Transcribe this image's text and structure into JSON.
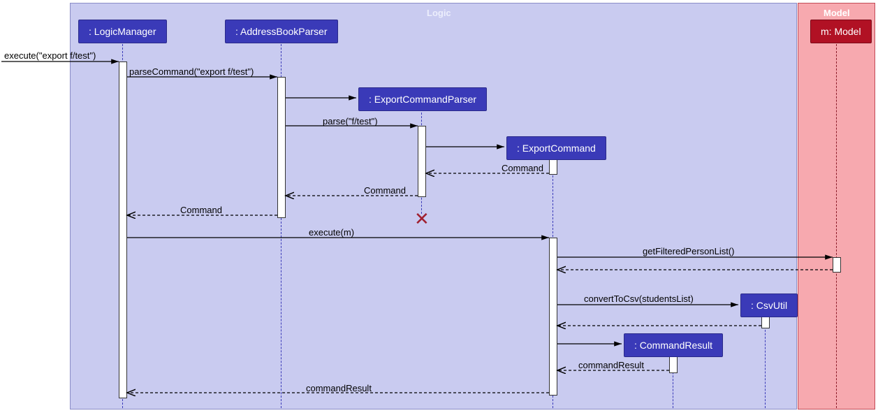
{
  "frames": {
    "logic": "Logic",
    "model": "Model"
  },
  "participants": {
    "logicManager": ": LogicManager",
    "addressBookParser": ": AddressBookParser",
    "exportCommandParser": ": ExportCommandParser",
    "exportCommand": ": ExportCommand",
    "csvUtil": ": CsvUtil",
    "commandResult": ": CommandResult",
    "model": "m: Model"
  },
  "messages": {
    "m1": "execute(\"export f/test\")",
    "m2": "parseCommand(\"export f/test\")",
    "m3": "parse(\"f/test\")",
    "r_command1": "Command",
    "r_command2": "Command",
    "r_command3": "Command",
    "m4": "execute(m)",
    "m5": "getFilteredPersonList()",
    "m6": "convertToCsv(studentsList)",
    "r_cr1": "commandResult",
    "r_cr2": "commandResult"
  },
  "chart_data": {
    "type": "sequence-diagram",
    "frames": [
      {
        "name": "Logic",
        "participants": [
          "LogicManager",
          "AddressBookParser",
          "ExportCommandParser",
          "ExportCommand",
          "CsvUtil",
          "CommandResult"
        ]
      },
      {
        "name": "Model",
        "participants": [
          "m: Model"
        ]
      }
    ],
    "participants": [
      {
        "id": "LogicManager",
        "label": ": LogicManager"
      },
      {
        "id": "AddressBookParser",
        "label": ": AddressBookParser"
      },
      {
        "id": "ExportCommandParser",
        "label": ": ExportCommandParser",
        "created_by": "AddressBookParser",
        "destroyed": true
      },
      {
        "id": "ExportCommand",
        "label": ": ExportCommand",
        "created_by": "ExportCommandParser"
      },
      {
        "id": "CsvUtil",
        "label": ": CsvUtil",
        "created_by": "ExportCommand"
      },
      {
        "id": "CommandResult",
        "label": ": CommandResult",
        "created_by": "ExportCommand"
      },
      {
        "id": "Model",
        "label": "m: Model"
      }
    ],
    "messages": [
      {
        "from": "(external)",
        "to": "LogicManager",
        "kind": "sync",
        "label": "execute(\"export f/test\")"
      },
      {
        "from": "LogicManager",
        "to": "AddressBookParser",
        "kind": "sync",
        "label": "parseCommand(\"export f/test\")"
      },
      {
        "from": "AddressBookParser",
        "to": "ExportCommandParser",
        "kind": "create",
        "label": ""
      },
      {
        "from": "AddressBookParser",
        "to": "ExportCommandParser",
        "kind": "sync",
        "label": "parse(\"f/test\")"
      },
      {
        "from": "ExportCommandParser",
        "to": "ExportCommand",
        "kind": "create",
        "label": ""
      },
      {
        "from": "ExportCommand",
        "to": "ExportCommandParser",
        "kind": "return",
        "label": "Command"
      },
      {
        "from": "ExportCommandParser",
        "to": "AddressBookParser",
        "kind": "return",
        "label": "Command"
      },
      {
        "from": "ExportCommandParser",
        "kind": "destroy"
      },
      {
        "from": "AddressBookParser",
        "to": "LogicManager",
        "kind": "return",
        "label": "Command"
      },
      {
        "from": "LogicManager",
        "to": "ExportCommand",
        "kind": "sync",
        "label": "execute(m)"
      },
      {
        "from": "ExportCommand",
        "to": "Model",
        "kind": "sync",
        "label": "getFilteredPersonList()"
      },
      {
        "from": "Model",
        "to": "ExportCommand",
        "kind": "return",
        "label": ""
      },
      {
        "from": "ExportCommand",
        "to": "CsvUtil",
        "kind": "create+sync",
        "label": "convertToCsv(studentsList)"
      },
      {
        "from": "CsvUtil",
        "to": "ExportCommand",
        "kind": "return",
        "label": ""
      },
      {
        "from": "ExportCommand",
        "to": "CommandResult",
        "kind": "create",
        "label": ""
      },
      {
        "from": "CommandResult",
        "to": "ExportCommand",
        "kind": "return",
        "label": "commandResult"
      },
      {
        "from": "ExportCommand",
        "to": "LogicManager",
        "kind": "return",
        "label": "commandResult"
      }
    ]
  }
}
